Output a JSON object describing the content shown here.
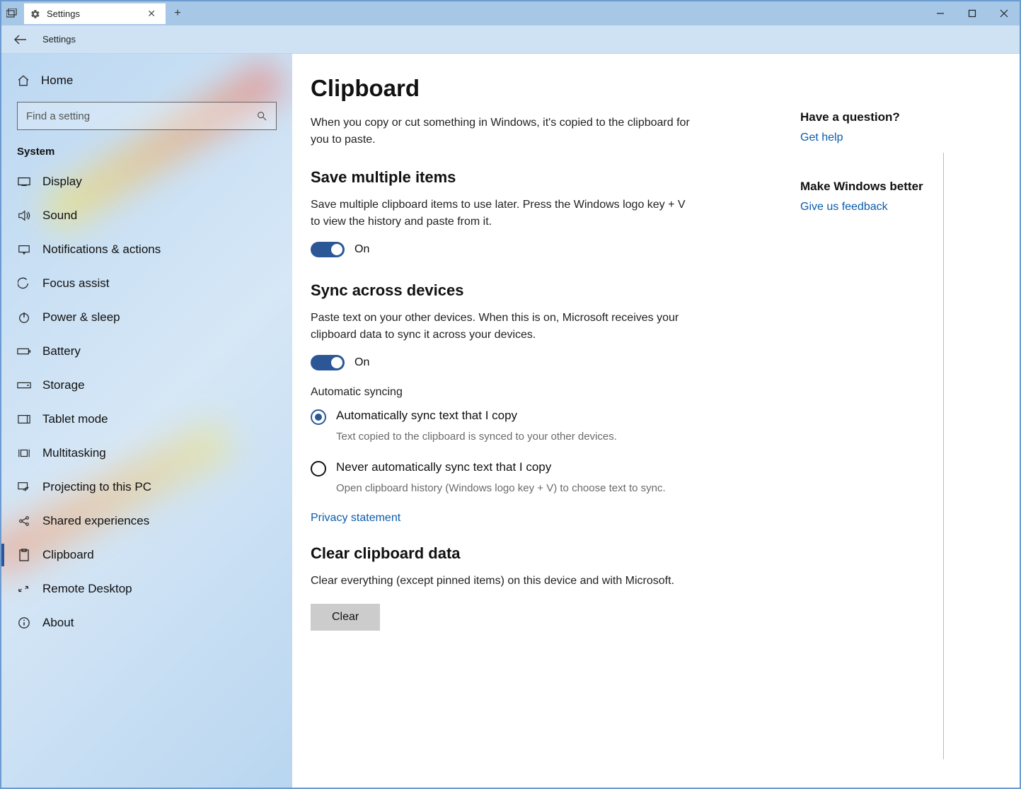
{
  "titlebar": {
    "tab_title": "Settings"
  },
  "nav": {
    "title": "Settings"
  },
  "sidebar": {
    "home": "Home",
    "search_placeholder": "Find a setting",
    "section": "System",
    "items": [
      {
        "label": "Display"
      },
      {
        "label": "Sound"
      },
      {
        "label": "Notifications & actions"
      },
      {
        "label": "Focus assist"
      },
      {
        "label": "Power & sleep"
      },
      {
        "label": "Battery"
      },
      {
        "label": "Storage"
      },
      {
        "label": "Tablet mode"
      },
      {
        "label": "Multitasking"
      },
      {
        "label": "Projecting to this PC"
      },
      {
        "label": "Shared experiences"
      },
      {
        "label": "Clipboard"
      },
      {
        "label": "Remote Desktop"
      },
      {
        "label": "About"
      }
    ]
  },
  "main": {
    "title": "Clipboard",
    "intro": "When you copy or cut something in Windows, it's copied to the clipboard for you to paste.",
    "save": {
      "heading": "Save multiple items",
      "desc": "Save multiple clipboard items to use later. Press the Windows logo key + V to view the history and paste from it.",
      "state": "On"
    },
    "sync": {
      "heading": "Sync across devices",
      "desc": "Paste text on your other devices. When this is on, Microsoft receives your clipboard data to sync it across your devices.",
      "state": "On",
      "autosync_label": "Automatic syncing",
      "opt1": "Automatically sync text that I copy",
      "opt1_sub": "Text copied to the clipboard is synced to your other devices.",
      "opt2": "Never automatically sync text that I copy",
      "opt2_sub": "Open clipboard history (Windows logo key + V) to choose text to sync."
    },
    "privacy_link": "Privacy statement",
    "clear": {
      "heading": "Clear clipboard data",
      "desc": "Clear everything (except pinned items) on this device and with Microsoft.",
      "button": "Clear"
    }
  },
  "right": {
    "q_heading": "Have a question?",
    "help_link": "Get help",
    "fb_heading": "Make Windows better",
    "fb_link": "Give us feedback"
  }
}
